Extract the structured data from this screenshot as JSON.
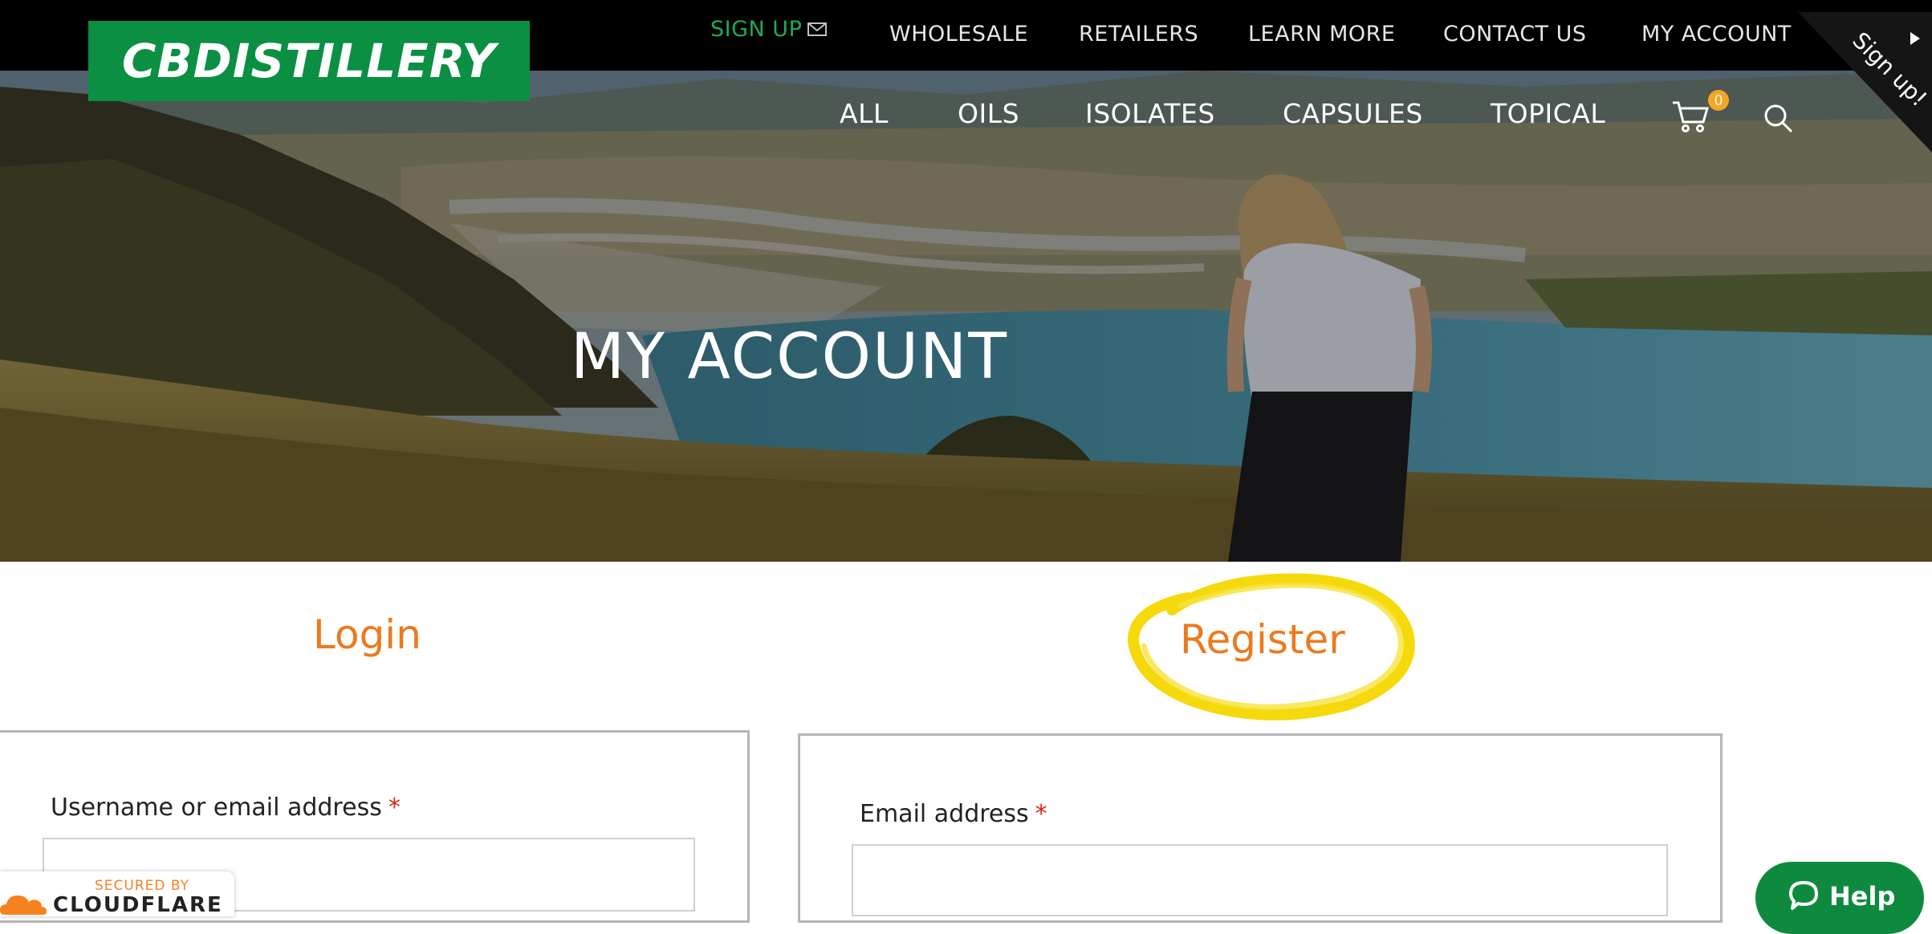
{
  "colors": {
    "brand_green": "#0a8f43",
    "signup_green": "#1faa57",
    "accent_orange": "#ec7a1e",
    "highlight_yellow": "#f5d90a",
    "required_red": "#e2231a",
    "help_green": "#0e8a3e"
  },
  "logo": {
    "text": "CBDISTILLERY"
  },
  "top_nav": {
    "signup_label": "SIGN UP",
    "signup_icon": "mail-icon",
    "items": [
      "WHOLESALE",
      "RETAILERS",
      "LEARN MORE",
      "CONTACT US",
      "MY ACCOUNT"
    ]
  },
  "ribbon": {
    "label": "Sign up!"
  },
  "category_nav": {
    "items": [
      "ALL",
      "OILS",
      "ISOLATES",
      "CAPSULES",
      "TOPICAL"
    ],
    "cart_icon": "cart-icon",
    "cart_count": "0",
    "search_icon": "search-icon"
  },
  "hero": {
    "title": "MY ACCOUNT"
  },
  "login": {
    "title": "Login",
    "username_label": "Username or email address",
    "required_mark": "*"
  },
  "register": {
    "title": "Register",
    "email_label": "Email address",
    "required_mark": "*"
  },
  "cloudflare": {
    "secured": "SECURED BY",
    "name": "CLOUDFLARE",
    "icon": "cloud-icon"
  },
  "help": {
    "label": "Help",
    "icon": "chat-bubble-icon"
  }
}
